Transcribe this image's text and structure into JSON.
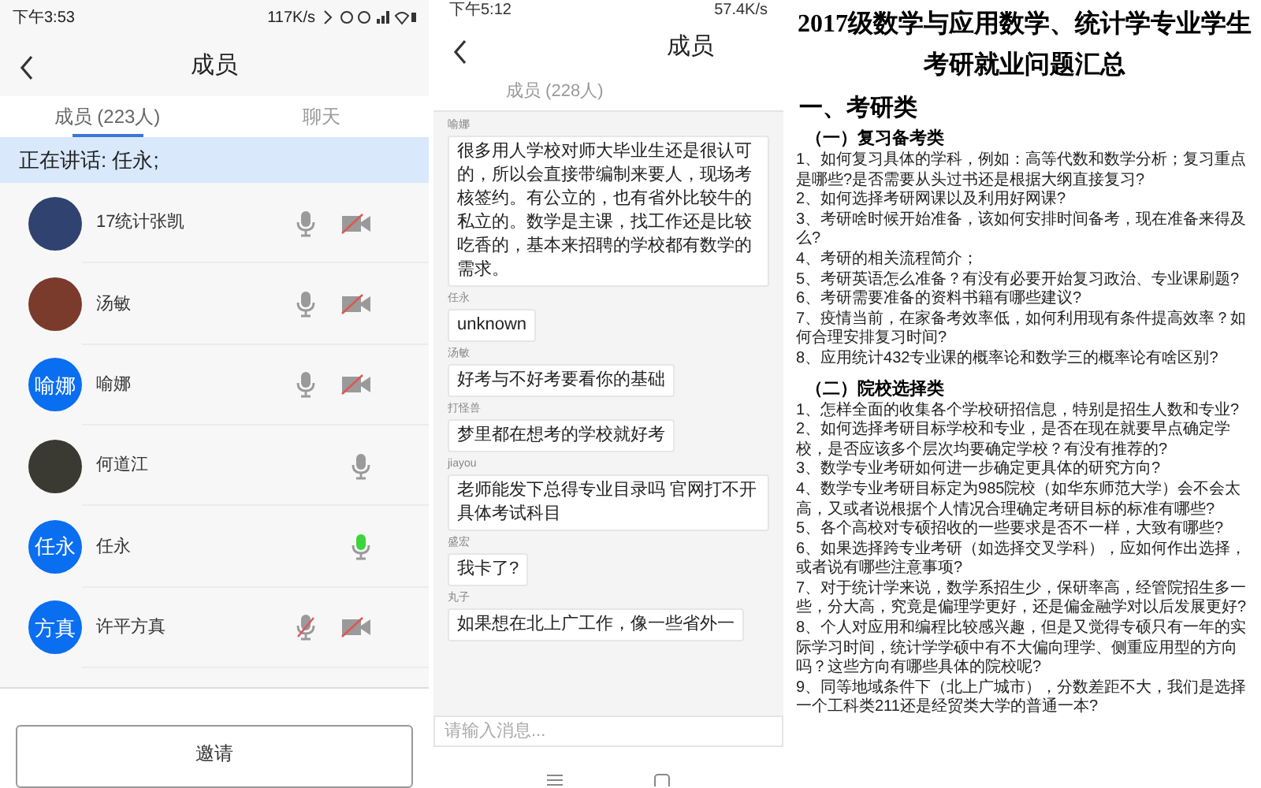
{
  "members_screen": {
    "status_bar": {
      "time": "下午3:53",
      "speed": "117K/s"
    },
    "title": "成员",
    "tabs": [
      {
        "label": "成员 (223人)",
        "selected": true
      },
      {
        "label": "聊天",
        "selected": false
      }
    ],
    "speaking": "正在讲话: 任永;",
    "members": [
      {
        "name": "17统计张凯",
        "avatar": {
          "kind": "photo",
          "color": "#2f4270"
        },
        "speaking": false,
        "mic_muted": false,
        "camera_off": true
      },
      {
        "name": "汤敏",
        "avatar": {
          "kind": "photo",
          "color": "#7a3a2c"
        },
        "speaking": false,
        "mic_muted": false,
        "camera_off": true
      },
      {
        "name": "喻娜",
        "avatar": {
          "kind": "text",
          "text": "喻娜"
        },
        "speaking": false,
        "mic_muted": false,
        "camera_off": true
      },
      {
        "name": "何道江",
        "avatar": {
          "kind": "photo",
          "color": "#3a3a32"
        },
        "speaking": false,
        "mic_muted": false,
        "camera_off": false
      },
      {
        "name": "任永",
        "avatar": {
          "kind": "text",
          "text": "任永"
        },
        "speaking": true,
        "mic_muted": false,
        "camera_off": false
      },
      {
        "name": "许平方真",
        "avatar": {
          "kind": "text",
          "text": "方真"
        },
        "speaking": false,
        "mic_muted": true,
        "camera_off": true
      }
    ],
    "invite_button": "邀请"
  },
  "chat_screen": {
    "status_bar": {
      "time": "下午5:12",
      "speed": "57.4K/s"
    },
    "title": "成员",
    "tab": "成员 (228人)",
    "messages": [
      {
        "sender": "喻娜",
        "text": "很多用人学校对师大毕业生还是很认可的，所以会直接带编制来要人，现场考核签约。有公立的，也有省外比较牛的私立的。数学是主课，找工作还是比较吃香的，基本来招聘的学校都有数学的需求。"
      },
      {
        "sender": "任永",
        "text": "unknown"
      },
      {
        "sender": "汤敏",
        "text": "好考与不好考要看你的基础"
      },
      {
        "sender": "打怪兽",
        "text": "梦里都在想考的学校就好考"
      },
      {
        "sender": "jiayou",
        "text": "老师能发下总得专业目录吗  官网打不开具体考试科目"
      },
      {
        "sender": "盛宏",
        "text": "我卡了?"
      },
      {
        "sender": "丸子",
        "text": "如果想在北上广工作，像一些省外一"
      }
    ],
    "input": {
      "placeholder": "请输入消息..."
    }
  },
  "document": {
    "title": [
      "2017级数学与应用数学、统计学专业学生",
      "考研就业问题汇总"
    ],
    "heading": "一、考研类",
    "sections": [
      {
        "title": "（一）复习备考类",
        "items": [
          "1、如何复习具体的学科，例如：高等代数和数学分析；复习重点是哪些?是否需要从头过书还是根据大纲直接复习?",
          "2、如何选择考研网课以及利用好网课?",
          "3、考研啥时候开始准备，该如何安排时间备考，现在准备来得及么?",
          "4、考研的相关流程简介；",
          "5、考研英语怎么准备？有没有必要开始复习政治、专业课刷题?",
          "6、考研需要准备的资料书籍有哪些建议?",
          "7、疫情当前，在家备考效率低，如何利用现有条件提高效率？如何合理安排复习时间?",
          "8、应用统计432专业课的概率论和数学三的概率论有啥区别?"
        ]
      },
      {
        "title": "（二）院校选择类",
        "items": [
          "1、怎样全面的收集各个学校研招信息，特别是招生人数和专业?",
          "2、如何选择考研目标学校和专业，是否在现在就要早点确定学校，是否应该多个层次均要确定学校？有没有推荐的?",
          "3、数学专业考研如何进一步确定更具体的研究方向?",
          "4、数学专业考研目标定为985院校（如华东师范大学）会不会太高，又或者说根据个人情况合理确定考研目标的标准有哪些?",
          "5、各个高校对专硕招收的一些要求是否不一样，大致有哪些?",
          "6、如果选择跨专业考研（如选择交叉学科），应如何作出选择，或者说有哪些注意事项?",
          "7、对于统计学来说，数学系招生少，保研率高，经管院招生多一些，分大高，究竟是偏理学更好，还是偏金融学对以后发展更好?",
          "8、个人对应用和编程比较感兴趣，但是又觉得专硕只有一年的实际学习时间，统计学学硕中有不大偏向理学、侧重应用型的方向吗？这些方向有哪些具体的院校呢?",
          "9、同等地域条件下（北上广城市），分数差距不大，我们是选择一个工科类211还是经贸类大学的普通一本?"
        ]
      }
    ]
  }
}
